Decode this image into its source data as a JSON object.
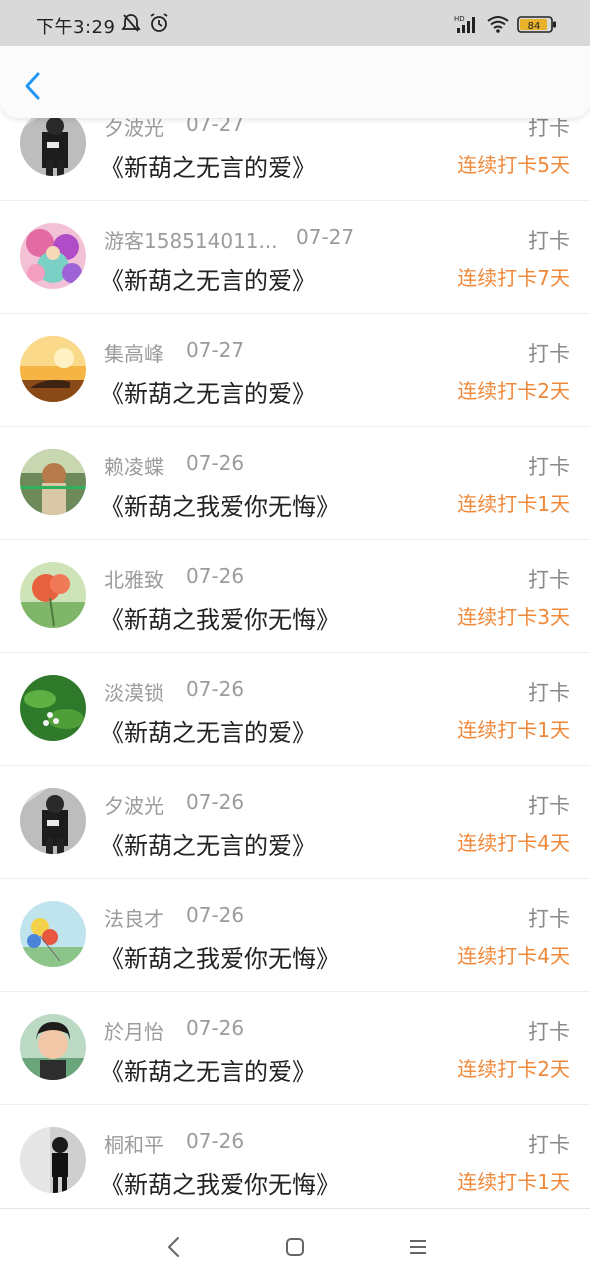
{
  "status_bar": {
    "time": "下午3:29",
    "network": "HD",
    "battery": "84",
    "icons": [
      "bell-off-icon",
      "alarm-icon",
      "signal-icon",
      "wifi-icon",
      "battery-icon"
    ]
  },
  "header": {
    "back_icon": "chevron-left-icon",
    "accent_color": "#2196f3"
  },
  "colors": {
    "streak": "#f0883a",
    "meta": "#9b9b9b",
    "title": "#222222"
  },
  "entries": [
    {
      "name": "夕波光",
      "date": "07-27",
      "title": "《新葫之无言的爱》",
      "action": "打卡",
      "streak": "连续打卡5天"
    },
    {
      "name": "游客158514011...",
      "date": "07-27",
      "title": "《新葫之无言的爱》",
      "action": "打卡",
      "streak": "连续打卡7天"
    },
    {
      "name": "集高峰",
      "date": "07-27",
      "title": "《新葫之无言的爱》",
      "action": "打卡",
      "streak": "连续打卡2天"
    },
    {
      "name": "赖凌蝶",
      "date": "07-26",
      "title": "《新葫之我爱你无悔》",
      "action": "打卡",
      "streak": "连续打卡1天"
    },
    {
      "name": "北雅致",
      "date": "07-26",
      "title": "《新葫之我爱你无悔》",
      "action": "打卡",
      "streak": "连续打卡3天"
    },
    {
      "name": "淡漠锁",
      "date": "07-26",
      "title": "《新葫之无言的爱》",
      "action": "打卡",
      "streak": "连续打卡1天"
    },
    {
      "name": "夕波光",
      "date": "07-26",
      "title": "《新葫之无言的爱》",
      "action": "打卡",
      "streak": "连续打卡4天"
    },
    {
      "name": "法良才",
      "date": "07-26",
      "title": "《新葫之我爱你无悔》",
      "action": "打卡",
      "streak": "连续打卡4天"
    },
    {
      "name": "於月怡",
      "date": "07-26",
      "title": "《新葫之无言的爱》",
      "action": "打卡",
      "streak": "连续打卡2天"
    },
    {
      "name": "桐和平",
      "date": "07-26",
      "title": "《新葫之我爱你无悔》",
      "action": "打卡",
      "streak": "连续打卡1天"
    }
  ],
  "nav_bar": {
    "icons": [
      "back-icon",
      "home-icon",
      "menu-icon"
    ]
  }
}
